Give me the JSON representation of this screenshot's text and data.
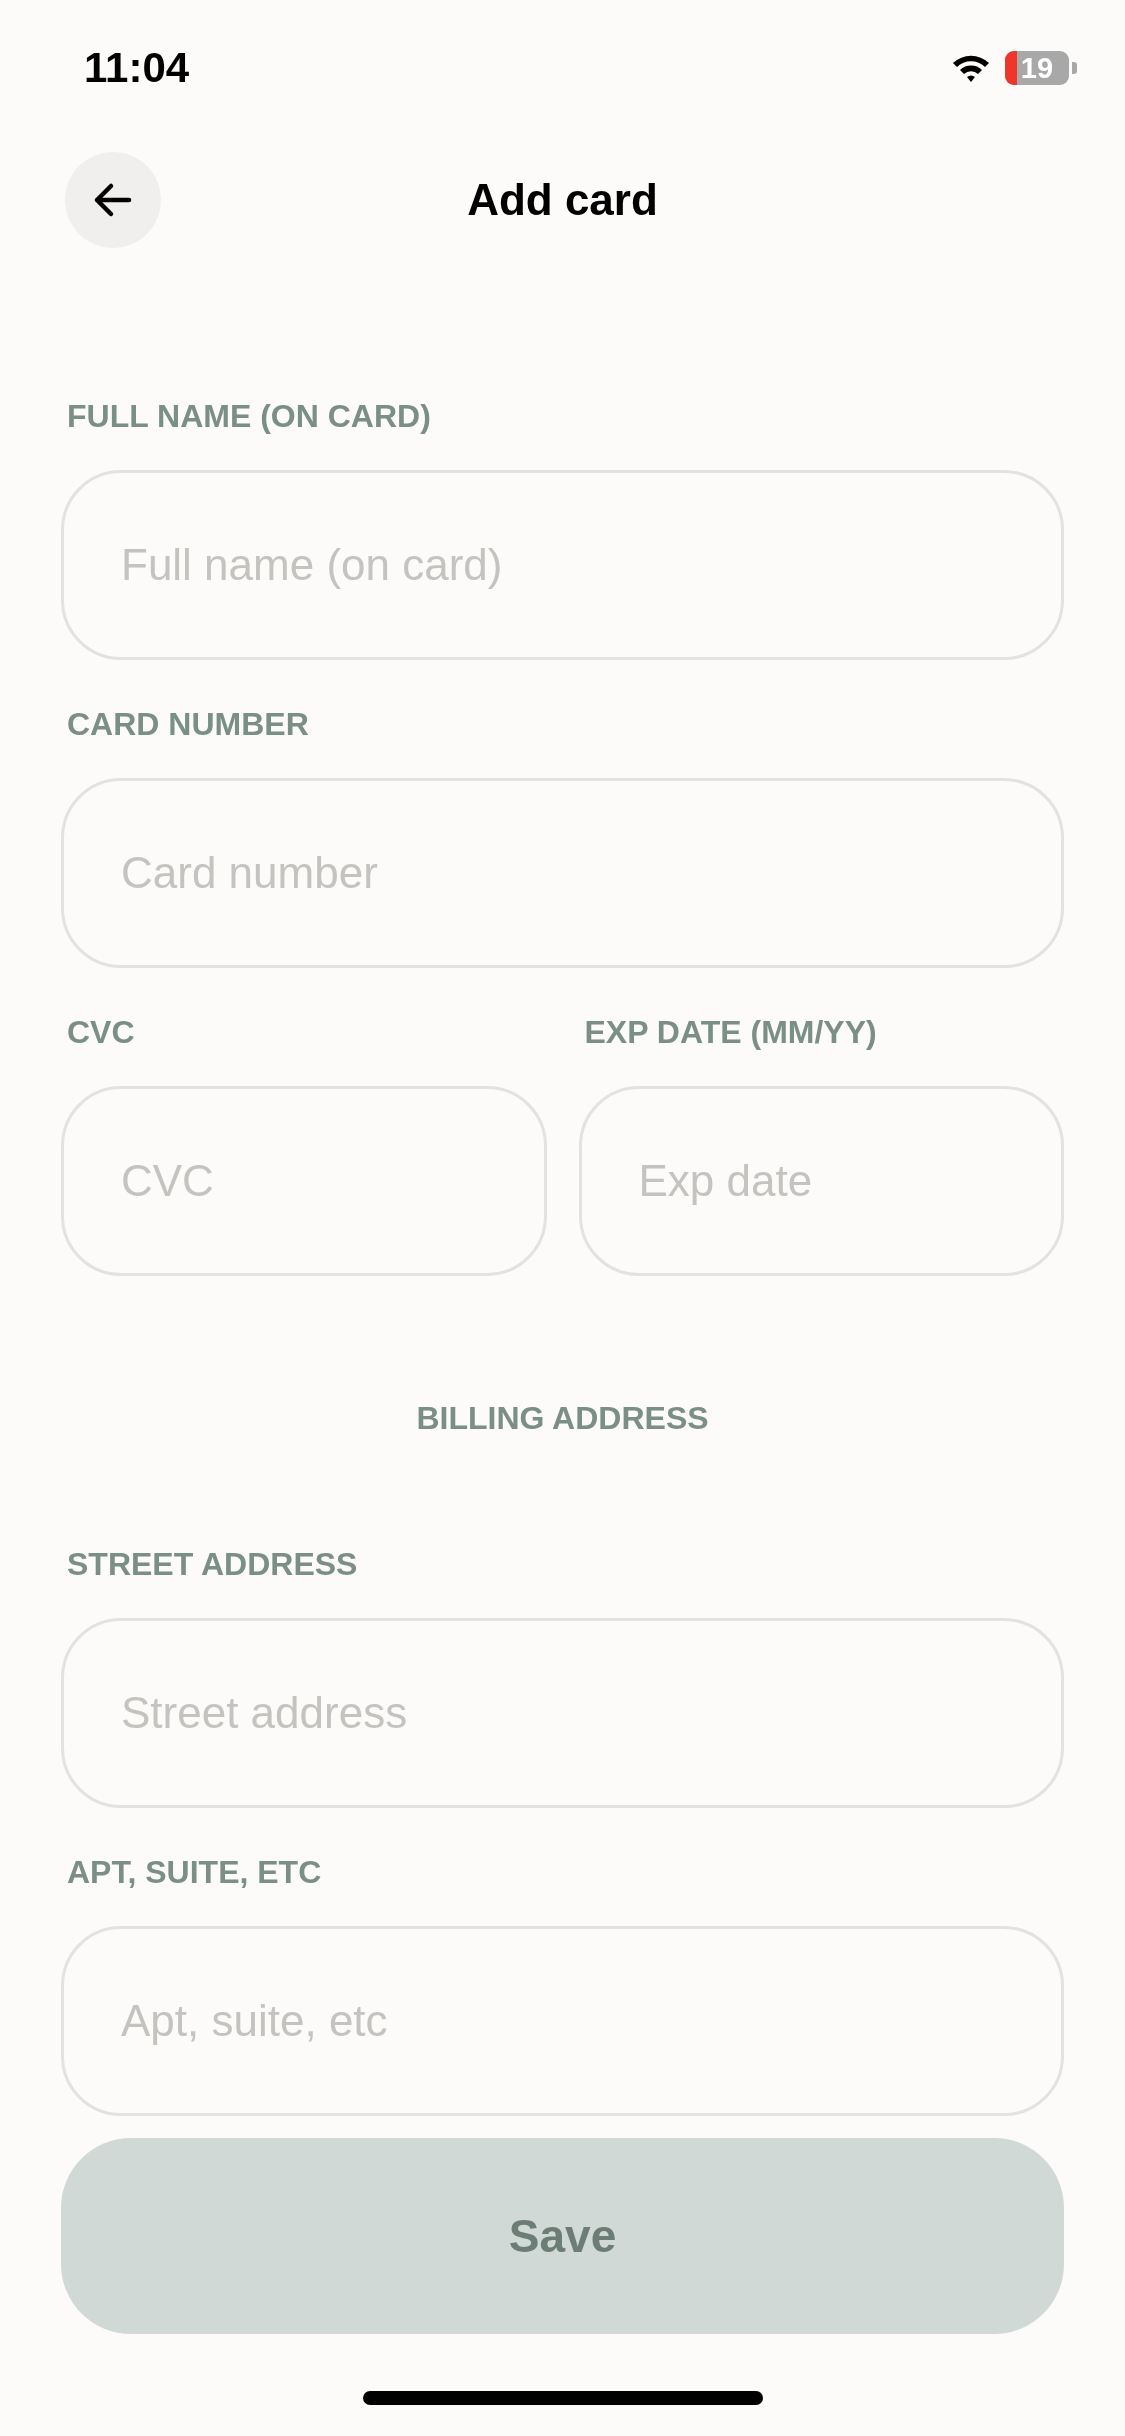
{
  "status_bar": {
    "time": "11:04",
    "battery": "19"
  },
  "header": {
    "title": "Add card"
  },
  "card_rows": [
    [
      {
        "label": "FULL NAME (ON CARD)",
        "placeholder": "Full name (on card)"
      }
    ],
    [
      {
        "label": "CARD NUMBER",
        "placeholder": "Card number"
      }
    ],
    [
      {
        "label": "CVC",
        "placeholder": "CVC"
      },
      {
        "label": "EXP DATE (MM/YY)",
        "placeholder": "Exp date"
      }
    ]
  ],
  "section_heading": "BILLING ADDRESS",
  "address_rows": [
    [
      {
        "label": "STREET ADDRESS",
        "placeholder": "Street address"
      }
    ],
    [
      {
        "label": "APT, SUITE, ETC",
        "placeholder": "Apt, suite, etc"
      }
    ]
  ],
  "save_button": {
    "label": "Save",
    "disabled": true
  }
}
